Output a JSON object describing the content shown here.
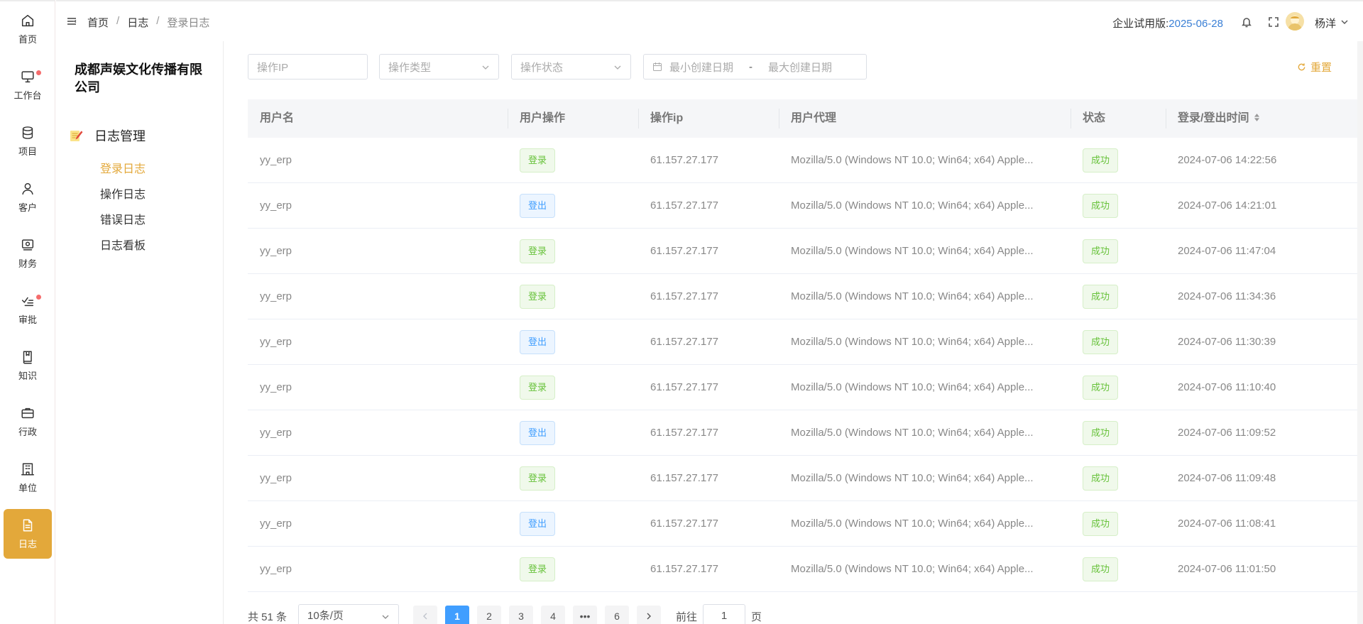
{
  "rail": [
    {
      "label": "首页",
      "icon": "home-icon"
    },
    {
      "label": "工作台",
      "icon": "monitor-icon",
      "dot": true
    },
    {
      "label": "项目",
      "icon": "database-icon"
    },
    {
      "label": "客户",
      "icon": "user-icon"
    },
    {
      "label": "财务",
      "icon": "finance-icon"
    },
    {
      "label": "审批",
      "icon": "approve-icon",
      "dot": true
    },
    {
      "label": "知识",
      "icon": "book-icon"
    },
    {
      "label": "行政",
      "icon": "briefcase-icon"
    },
    {
      "label": "单位",
      "icon": "building-icon"
    },
    {
      "label": "日志",
      "icon": "document-icon",
      "active": true
    }
  ],
  "header": {
    "breadcrumb": [
      "首页",
      "日志",
      "登录日志"
    ],
    "trial_label": "企业试用版:",
    "trial_date": "2025-06-28",
    "username": "杨洋"
  },
  "subside": {
    "company": "成都声娱文化传播有限公司",
    "menu_title": "日志管理",
    "items": [
      "登录日志",
      "操作日志",
      "错误日志",
      "日志看板"
    ],
    "active_index": 0
  },
  "filters": {
    "ip_placeholder": "操作IP",
    "type_placeholder": "操作类型",
    "status_placeholder": "操作状态",
    "date_start_placeholder": "最小创建日期",
    "date_sep": "-",
    "date_end_placeholder": "最大创建日期",
    "reset_label": "重置"
  },
  "table": {
    "columns": [
      "用户名",
      "用户操作",
      "操作ip",
      "用户代理",
      "状态",
      "登录/登出时间"
    ],
    "rows": [
      {
        "user": "yy_erp",
        "action": "登录",
        "type": "login",
        "ip": "61.157.27.177",
        "agent": "Mozilla/5.0 (Windows NT 10.0; Win64; x64) Apple...",
        "status": "成功",
        "time": "2024-07-06 14:22:56"
      },
      {
        "user": "yy_erp",
        "action": "登出",
        "type": "logout",
        "ip": "61.157.27.177",
        "agent": "Mozilla/5.0 (Windows NT 10.0; Win64; x64) Apple...",
        "status": "成功",
        "time": "2024-07-06 14:21:01"
      },
      {
        "user": "yy_erp",
        "action": "登录",
        "type": "login",
        "ip": "61.157.27.177",
        "agent": "Mozilla/5.0 (Windows NT 10.0; Win64; x64) Apple...",
        "status": "成功",
        "time": "2024-07-06 11:47:04"
      },
      {
        "user": "yy_erp",
        "action": "登录",
        "type": "login",
        "ip": "61.157.27.177",
        "agent": "Mozilla/5.0 (Windows NT 10.0; Win64; x64) Apple...",
        "status": "成功",
        "time": "2024-07-06 11:34:36"
      },
      {
        "user": "yy_erp",
        "action": "登出",
        "type": "logout",
        "ip": "61.157.27.177",
        "agent": "Mozilla/5.0 (Windows NT 10.0; Win64; x64) Apple...",
        "status": "成功",
        "time": "2024-07-06 11:30:39"
      },
      {
        "user": "yy_erp",
        "action": "登录",
        "type": "login",
        "ip": "61.157.27.177",
        "agent": "Mozilla/5.0 (Windows NT 10.0; Win64; x64) Apple...",
        "status": "成功",
        "time": "2024-07-06 11:10:40"
      },
      {
        "user": "yy_erp",
        "action": "登出",
        "type": "logout",
        "ip": "61.157.27.177",
        "agent": "Mozilla/5.0 (Windows NT 10.0; Win64; x64) Apple...",
        "status": "成功",
        "time": "2024-07-06 11:09:52"
      },
      {
        "user": "yy_erp",
        "action": "登录",
        "type": "login",
        "ip": "61.157.27.177",
        "agent": "Mozilla/5.0 (Windows NT 10.0; Win64; x64) Apple...",
        "status": "成功",
        "time": "2024-07-06 11:09:48"
      },
      {
        "user": "yy_erp",
        "action": "登出",
        "type": "logout",
        "ip": "61.157.27.177",
        "agent": "Mozilla/5.0 (Windows NT 10.0; Win64; x64) Apple...",
        "status": "成功",
        "time": "2024-07-06 11:08:41"
      },
      {
        "user": "yy_erp",
        "action": "登录",
        "type": "login",
        "ip": "61.157.27.177",
        "agent": "Mozilla/5.0 (Windows NT 10.0; Win64; x64) Apple...",
        "status": "成功",
        "time": "2024-07-06 11:01:50"
      }
    ]
  },
  "pagination": {
    "total": "共 51 条",
    "page_size": "10条/页",
    "pages": [
      "1",
      "2",
      "3",
      "4",
      "•••",
      "6"
    ],
    "current": "1",
    "goto_label": "前往",
    "goto_value": "1",
    "page_suffix": "页"
  },
  "colors": {
    "accent": "#e3a83a",
    "primary": "#409eff",
    "success": "#67c23a",
    "trial_date": "#3a7fd5"
  }
}
